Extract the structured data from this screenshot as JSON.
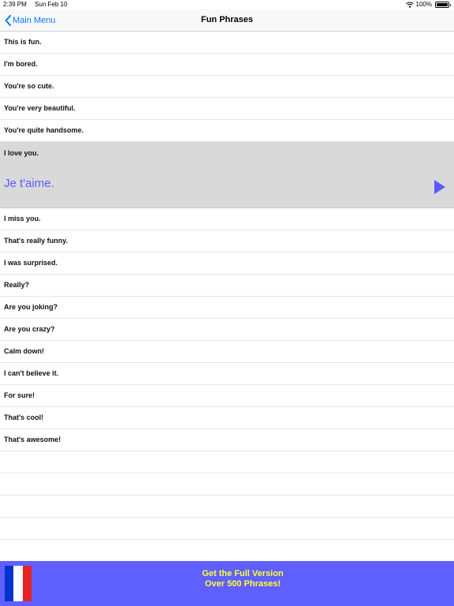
{
  "status_bar": {
    "time": "2:39 PM",
    "date": "Sun Feb 10",
    "battery": "100%",
    "battery_level": 1.0
  },
  "nav": {
    "back_label": "Main Menu",
    "title": "Fun Phrases"
  },
  "phrases": [
    "This is fun.",
    "I'm bored.",
    "You're so cute.",
    "You're very beautiful.",
    "You're quite handsome."
  ],
  "selected": {
    "phrase": "I love you.",
    "translation": "Je t'aime."
  },
  "phrases_after": [
    "I miss you.",
    "That's really funny.",
    "I was surprised.",
    "Really?",
    "Are you joking?",
    "Are you crazy?",
    "Calm down!",
    "I can't believe it.",
    "For sure!",
    "That's cool!",
    "That's awesome!"
  ],
  "promo": {
    "line1": "Get the Full Version",
    "line2": "Over 500 Phrases!"
  },
  "colors": {
    "accent": "#007aff",
    "translation": "#5b5bff",
    "banner": "#6060ff",
    "banner_text": "#ffff33",
    "selected_row": "#d9d9d9",
    "flag_blue": "#0033cc",
    "flag_white": "#ffffff",
    "flag_red": "#e52222"
  }
}
